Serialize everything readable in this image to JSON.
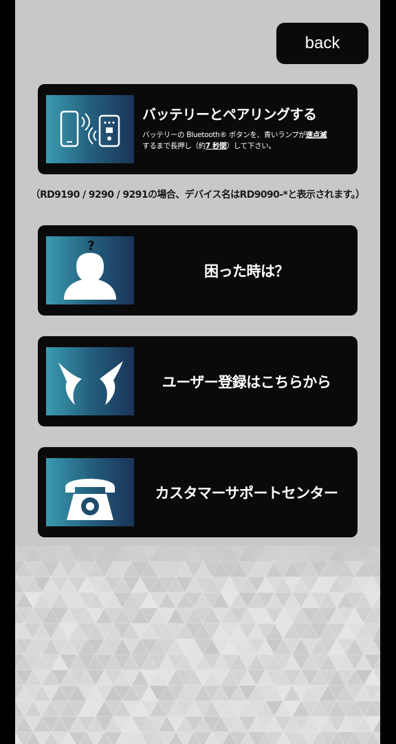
{
  "header": {
    "back_label": "back"
  },
  "pairing": {
    "title": "バッテリーとペアリングする",
    "desc_part1": "バッテリーの Bluetooth® ボタンを、青いランプが",
    "desc_emph1": "速点滅",
    "desc_part2": "するまで長押し（約",
    "desc_emph2": "7 秒間",
    "desc_part3": "）して下さい。",
    "icon": "phone-bluetooth-pairing-icon"
  },
  "device_note": "（RD9190 / 9290 / 9291の場合、デバイス名はRD9090-*と表示されます。）",
  "menu": [
    {
      "label": "困った時は？",
      "icon": "help-person-icon"
    },
    {
      "label": "ユーザー登録はこちらから",
      "icon": "brand-logo-icon"
    },
    {
      "label": "カスタマーサポートセンター",
      "icon": "telephone-icon"
    }
  ],
  "colors": {
    "background": "#c8c8c8",
    "card": "#0a0a0a",
    "thumb_gradient_start": "#3a9bb0",
    "thumb_gradient_end": "#1a3358",
    "text_light": "#ffffff"
  }
}
